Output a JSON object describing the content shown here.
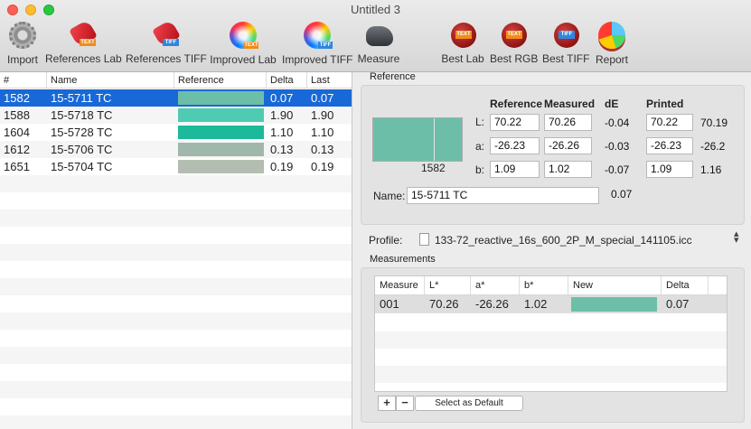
{
  "window": {
    "title": "Untitled 3"
  },
  "toolbar": [
    {
      "label": "Import",
      "icon": "gear-icon"
    },
    {
      "label": "References Lab",
      "icon": "tag-text-icon",
      "badge": "TEXT"
    },
    {
      "label": "References TIFF",
      "icon": "tag-tiff-icon",
      "badge": "TIFF"
    },
    {
      "label": "Improved Lab",
      "icon": "color-wheel-text-icon",
      "badge": "TEXT"
    },
    {
      "label": "Improved TIFF",
      "icon": "color-wheel-tiff-icon",
      "badge": "TIFF"
    },
    {
      "label": "Measure",
      "icon": "spectrophotometer-icon"
    },
    {
      "label": "Best Lab",
      "icon": "seal-text-icon",
      "badge": "TEXT"
    },
    {
      "label": "Best RGB",
      "icon": "seal-text-icon",
      "badge": "TEXT"
    },
    {
      "label": "Best TIFF",
      "icon": "seal-tiff-icon",
      "badge": "TIFF"
    },
    {
      "label": "Report",
      "icon": "pie-chart-icon"
    }
  ],
  "list": {
    "columns": [
      "#",
      "Name",
      "Reference",
      "Delta",
      "Last"
    ],
    "rows": [
      {
        "num": "1582",
        "name": "15-5711 TC",
        "color": "#6dbea9",
        "delta": "0.07",
        "last": "0.07",
        "selected": true
      },
      {
        "num": "1588",
        "name": "15-5718 TC",
        "color": "#4ecbb1",
        "delta": "1.90",
        "last": "1.90",
        "selected": false
      },
      {
        "num": "1604",
        "name": "15-5728 TC",
        "color": "#1cba9b",
        "delta": "1.10",
        "last": "1.10",
        "selected": false
      },
      {
        "num": "1612",
        "name": "15-5706 TC",
        "color": "#9fb8ab",
        "delta": "0.13",
        "last": "0.13",
        "selected": false
      },
      {
        "num": "1651",
        "name": "15-5704 TC",
        "color": "#b4bdb1",
        "delta": "0.19",
        "last": "0.19",
        "selected": false
      }
    ]
  },
  "reference": {
    "group_title": "Reference",
    "swatch_number": "1582",
    "swatch_color": "#6dbea9",
    "headers": {
      "reference": "Reference",
      "measured": "Measured",
      "de": "dE",
      "printed": "Printed"
    },
    "rows": [
      {
        "label": "L:",
        "reference": "70.22",
        "measured": "70.26",
        "de": "-0.04",
        "printed": "70.22",
        "extra": "70.19"
      },
      {
        "label": "a:",
        "reference": "-26.23",
        "measured": "-26.26",
        "de": "-0.03",
        "printed": "-26.23",
        "extra": "-26.2"
      },
      {
        "label": "b:",
        "reference": "1.09",
        "measured": "1.02",
        "de": "-0.07",
        "printed": "1.09",
        "extra": "1.16"
      }
    ],
    "name_label": "Name:",
    "name_value": "15-5711 TC",
    "total_de": "0.07"
  },
  "profile": {
    "label": "Profile:",
    "value": "133-72_reactive_16s_600_2P_M_special_141105.icc"
  },
  "measurements": {
    "group_title": "Measurements",
    "columns": [
      "Measure",
      "L*",
      "a*",
      "b*",
      "New",
      "Delta"
    ],
    "rows": [
      {
        "measure": "001",
        "l": "70.26",
        "a": "-26.26",
        "b": "1.02",
        "new_color": "#6dbea9",
        "delta": "0.07"
      }
    ],
    "add_label": "+",
    "remove_label": "−",
    "default_label": "Select as Default"
  }
}
